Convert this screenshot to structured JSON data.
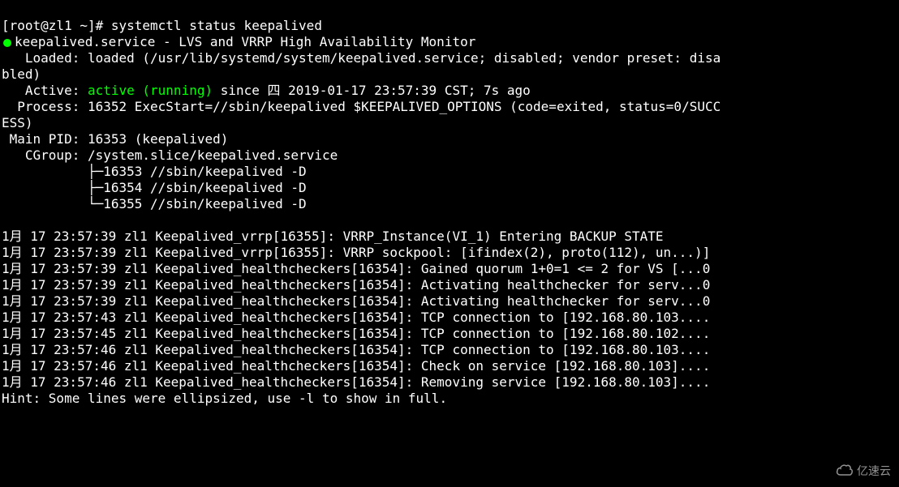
{
  "colors": {
    "term_green": "#00ff00",
    "bg": "#000000",
    "fg": "#ffffff"
  },
  "prompt": "[root@zl1 ~]# ",
  "command": "systemctl status keepalived",
  "service": {
    "unit": "keepalived.service",
    "unit_sep": " - ",
    "description": "LVS and VRRP High Availability Monitor",
    "loaded_label": "   Loaded: ",
    "loaded_value": "loaded (/usr/lib/systemd/system/keepalived.service; disabled; vendor preset: disa",
    "loaded_value_cont": "bled)",
    "active_label": "   Active: ",
    "active_state": "active (running)",
    "active_since": " since 四 2019-01-17 23:57:39 CST; 7s ago",
    "process_label": "  Process: ",
    "process_value": "16352 ExecStart=//sbin/keepalived $KEEPALIVED_OPTIONS (code=exited, status=0/SUCC",
    "process_value_cont": "ESS)",
    "main_pid_label": " Main PID: ",
    "main_pid_value": "16353 (keepalived)",
    "cgroup_label": "   CGroup: ",
    "cgroup_path": "/system.slice/keepalived.service",
    "cgroup_children": [
      "           ├─16353 //sbin/keepalived -D",
      "           ├─16354 //sbin/keepalived -D",
      "           └─16355 //sbin/keepalived -D"
    ]
  },
  "logs": [
    "1月 17 23:57:39 zl1 Keepalived_vrrp[16355]: VRRP_Instance(VI_1) Entering BACKUP STATE",
    "1月 17 23:57:39 zl1 Keepalived_vrrp[16355]: VRRP sockpool: [ifindex(2), proto(112), un...)]",
    "1月 17 23:57:39 zl1 Keepalived_healthcheckers[16354]: Gained quorum 1+0=1 <= 2 for VS [...0",
    "1月 17 23:57:39 zl1 Keepalived_healthcheckers[16354]: Activating healthchecker for serv...0",
    "1月 17 23:57:39 zl1 Keepalived_healthcheckers[16354]: Activating healthchecker for serv...0",
    "1月 17 23:57:43 zl1 Keepalived_healthcheckers[16354]: TCP connection to [192.168.80.103....",
    "1月 17 23:57:45 zl1 Keepalived_healthcheckers[16354]: TCP connection to [192.168.80.102....",
    "1月 17 23:57:46 zl1 Keepalived_healthcheckers[16354]: TCP connection to [192.168.80.103....",
    "1月 17 23:57:46 zl1 Keepalived_healthcheckers[16354]: Check on service [192.168.80.103]....",
    "1月 17 23:57:46 zl1 Keepalived_healthcheckers[16354]: Removing service [192.168.80.103]...."
  ],
  "hint": "Hint: Some lines were ellipsized, use -l to show in full.",
  "watermark_text": "亿速云"
}
